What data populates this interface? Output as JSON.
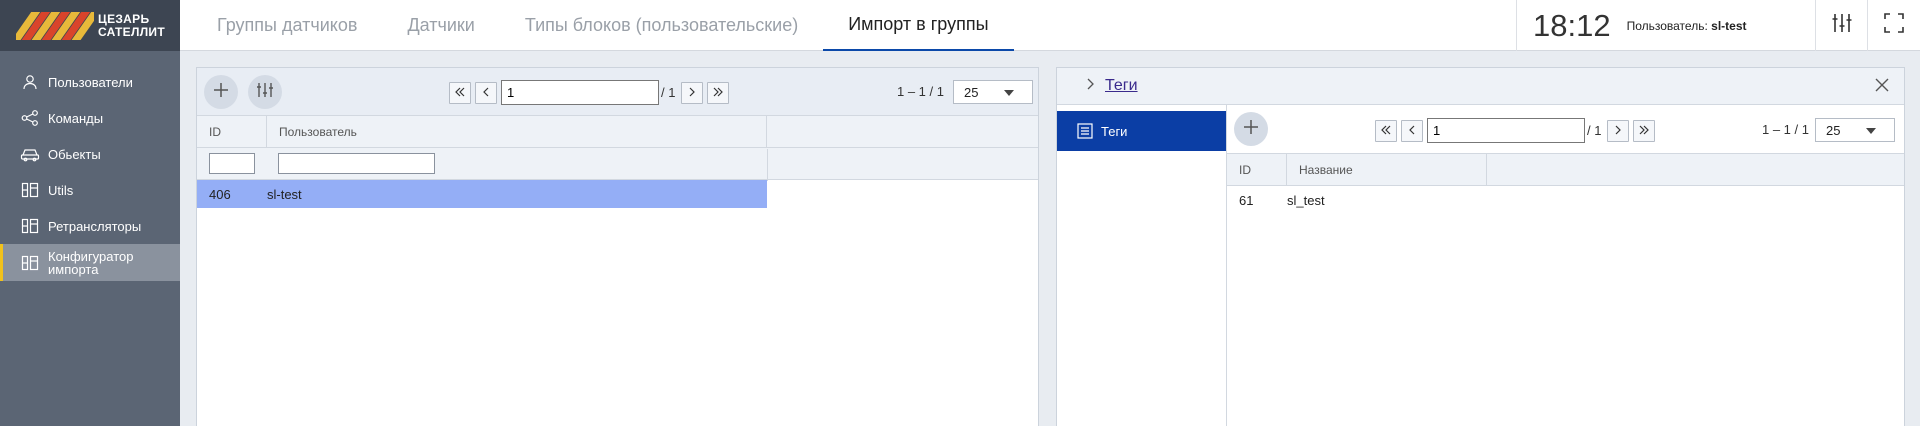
{
  "logo": {
    "line1": "ЦЕЗАРЬ",
    "line2": "САТЕЛЛИТ"
  },
  "sidebar": {
    "items": [
      {
        "label": "Пользователи",
        "icon": "user-icon"
      },
      {
        "label": "Команды",
        "icon": "share-nodes-icon"
      },
      {
        "label": "Обьекты",
        "icon": "car-icon"
      },
      {
        "label": "Utils",
        "icon": "blocks-icon"
      },
      {
        "label": "Ретрансляторы",
        "icon": "blocks-icon"
      },
      {
        "label_line1": "Конфигуратор",
        "label_line2": "импорта",
        "icon": "blocks-icon",
        "active": true
      }
    ]
  },
  "tabs": [
    "Группы датчиков",
    "Датчики",
    "Типы блоков (пользовательские)",
    "Импорт в группы"
  ],
  "active_tab": "Импорт в группы",
  "header": {
    "time": "18:12",
    "user_prefix": "Пользователь:",
    "user_name": "sl-test"
  },
  "left_panel": {
    "pager": {
      "page": "1",
      "total": "/ 1",
      "range": "1 – 1 / 1",
      "page_size": "25"
    },
    "columns": [
      "ID",
      "Пользователь"
    ],
    "rows": [
      {
        "id": "406",
        "user": "sl-test",
        "selected": true
      }
    ]
  },
  "right_panel": {
    "header_link": "Теги",
    "side_item": "Теги",
    "pager": {
      "page": "1",
      "total": "/ 1",
      "range": "1 – 1 / 1",
      "page_size": "25"
    },
    "columns": [
      "ID",
      "Название"
    ],
    "rows": [
      {
        "id": "61",
        "name": "sl_test"
      }
    ]
  },
  "colors": {
    "accent": "#0b3ea5",
    "selected_row": "#94aef6",
    "sidebar_bg": "#5b6574",
    "active_marker": "#f2c21b"
  }
}
